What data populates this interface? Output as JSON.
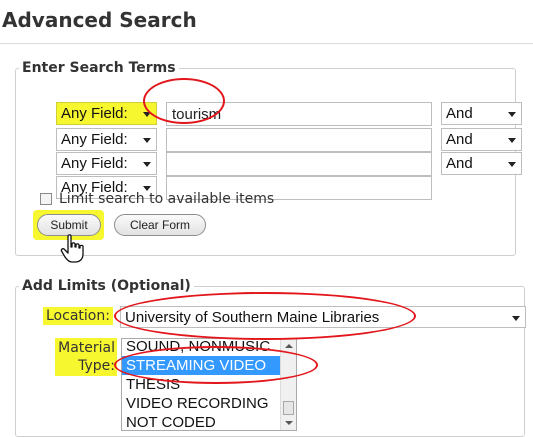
{
  "page": {
    "title": "Advanced Search"
  },
  "search_terms": {
    "legend": "Enter Search Terms",
    "rows": [
      {
        "field": "Any Field:",
        "value": "tourism",
        "bool": "And"
      },
      {
        "field": "Any Field:",
        "value": "",
        "bool": "And"
      },
      {
        "field": "Any Field:",
        "value": "",
        "bool": "And"
      },
      {
        "field": "Any Field:",
        "value": ""
      }
    ],
    "limit_checkbox_label": "Limit search to available items",
    "limit_checked": false,
    "submit_label": "Submit",
    "clear_label": "Clear Form"
  },
  "limits": {
    "legend": "Add Limits (Optional)",
    "location_label": "Location:",
    "location_value": "University of Southern Maine Libraries",
    "material_type_label_1": "Material",
    "material_type_label_2": "Type:",
    "material_type_options": [
      "SOUND, NONMUSIC",
      "STREAMING VIDEO",
      "THESIS",
      "VIDEO RECORDING",
      "NOT CODED"
    ],
    "material_type_selected": "STREAMING VIDEO"
  },
  "colors": {
    "highlight": "#f7f72f",
    "annotation": "#e2161b",
    "selection": "#3399ff"
  },
  "icons": {
    "dropdown": "chevron-down-icon",
    "cursor": "hand-pointer-icon"
  }
}
